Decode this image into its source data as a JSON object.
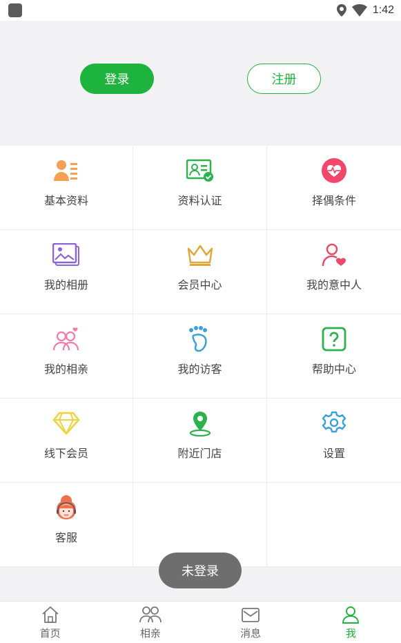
{
  "status_bar": {
    "time": "1:42"
  },
  "header": {
    "login_label": "登录",
    "register_label": "注册"
  },
  "menu": [
    {
      "label": "基本资料",
      "icon": "profile-card-icon",
      "color": "#f4a155"
    },
    {
      "label": "资料认证",
      "icon": "id-verified-icon",
      "color": "#2bb24c"
    },
    {
      "label": "择偶条件",
      "icon": "heart-pulse-icon",
      "color": "#f2476a"
    },
    {
      "label": "我的相册",
      "icon": "album-icon",
      "color": "#8e63d8"
    },
    {
      "label": "会员中心",
      "icon": "crown-icon",
      "color": "#e0a83a"
    },
    {
      "label": "我的意中人",
      "icon": "user-heart-icon",
      "color": "#e84a6a"
    },
    {
      "label": "我的相亲",
      "icon": "couple-icon",
      "color": "#f07aa8"
    },
    {
      "label": "我的访客",
      "icon": "footprint-icon",
      "color": "#3aa0d8"
    },
    {
      "label": "帮助中心",
      "icon": "help-icon",
      "color": "#2bb24c"
    },
    {
      "label": "线下会员",
      "icon": "diamond-icon",
      "color": "#f0d23a"
    },
    {
      "label": "附近门店",
      "icon": "location-pin-icon",
      "color": "#2bb24c"
    },
    {
      "label": "设置",
      "icon": "gear-icon",
      "color": "#3aa0d8"
    },
    {
      "label": "客服",
      "icon": "customer-service-icon",
      "color": "#f07050"
    }
  ],
  "toast": "未登录",
  "tabs": [
    {
      "label": "首页",
      "icon": "home-icon",
      "active": false
    },
    {
      "label": "相亲",
      "icon": "people-icon",
      "active": false
    },
    {
      "label": "消息",
      "icon": "mail-icon",
      "active": false
    },
    {
      "label": "我",
      "icon": "user-icon",
      "active": true
    }
  ],
  "accent_color": "#1db33c"
}
